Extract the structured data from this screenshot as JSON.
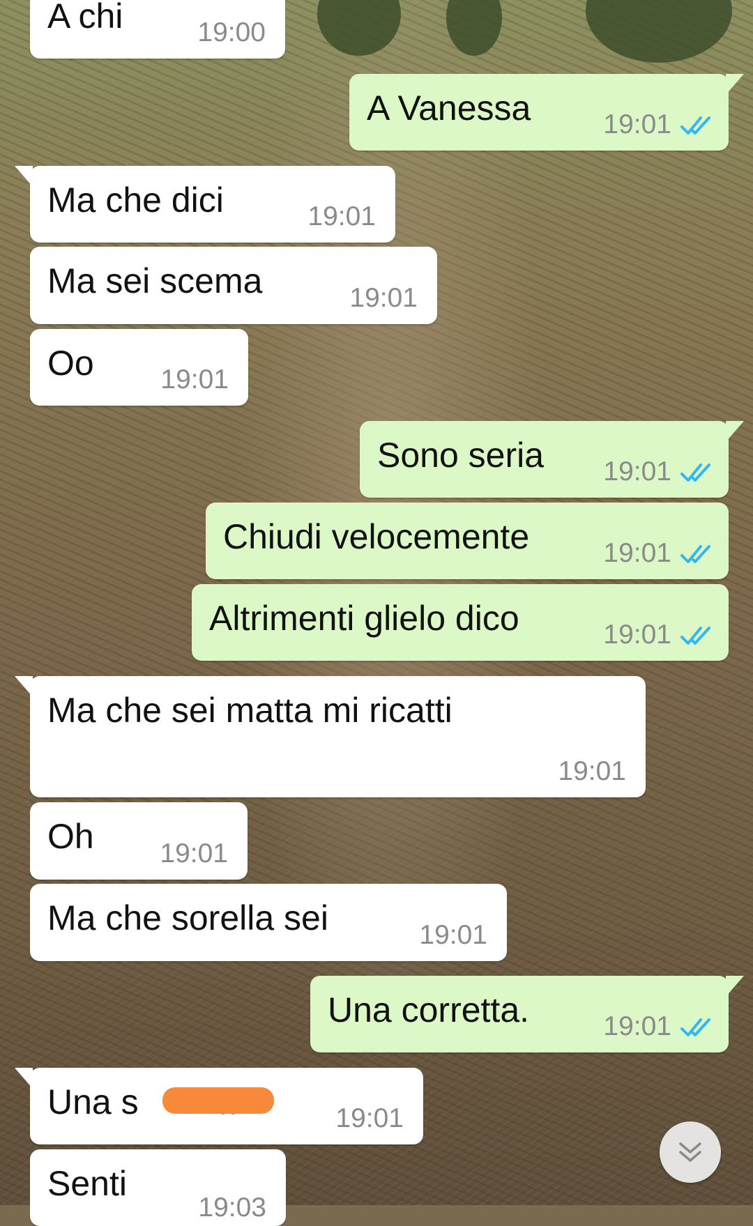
{
  "chat": {
    "messages": [
      {
        "dir": "in",
        "text": "A chi",
        "time": "19:00"
      },
      {
        "dir": "out",
        "text": "A Vanessa",
        "time": "19:01",
        "status": "read"
      },
      {
        "dir": "in",
        "text": "Ma che dici",
        "time": "19:01"
      },
      {
        "dir": "in",
        "text": "Ma sei scema",
        "time": "19:01"
      },
      {
        "dir": "in",
        "text": "Oo",
        "time": "19:01"
      },
      {
        "dir": "out",
        "text": "Sono seria",
        "time": "19:01",
        "status": "read"
      },
      {
        "dir": "out",
        "text": "Chiudi velocemente",
        "time": "19:01",
        "status": "read"
      },
      {
        "dir": "out",
        "text": "Altrimenti glielo dico",
        "time": "19:01",
        "status": "read"
      },
      {
        "dir": "in",
        "text": "Ma che sei matta mi ricatti",
        "time": "19:01"
      },
      {
        "dir": "in",
        "text": "Oh",
        "time": "19:01"
      },
      {
        "dir": "in",
        "text": "Ma che sorella sei",
        "time": "19:01"
      },
      {
        "dir": "out",
        "text": "Una corretta.",
        "time": "19:01",
        "status": "read"
      },
      {
        "dir": "in",
        "text": "Una s        a!",
        "time": "19:01",
        "redacted": true
      },
      {
        "dir": "in",
        "text": "Senti",
        "time": "19:03"
      }
    ]
  },
  "colors": {
    "incoming_bubble": "#ffffff",
    "outgoing_bubble": "#dcf8c6",
    "read_ticks": "#34b7f1",
    "redaction": "#f68a3a"
  },
  "icons": {
    "read_status": "double-check-icon",
    "scroll_down": "double-chevron-down-icon"
  }
}
